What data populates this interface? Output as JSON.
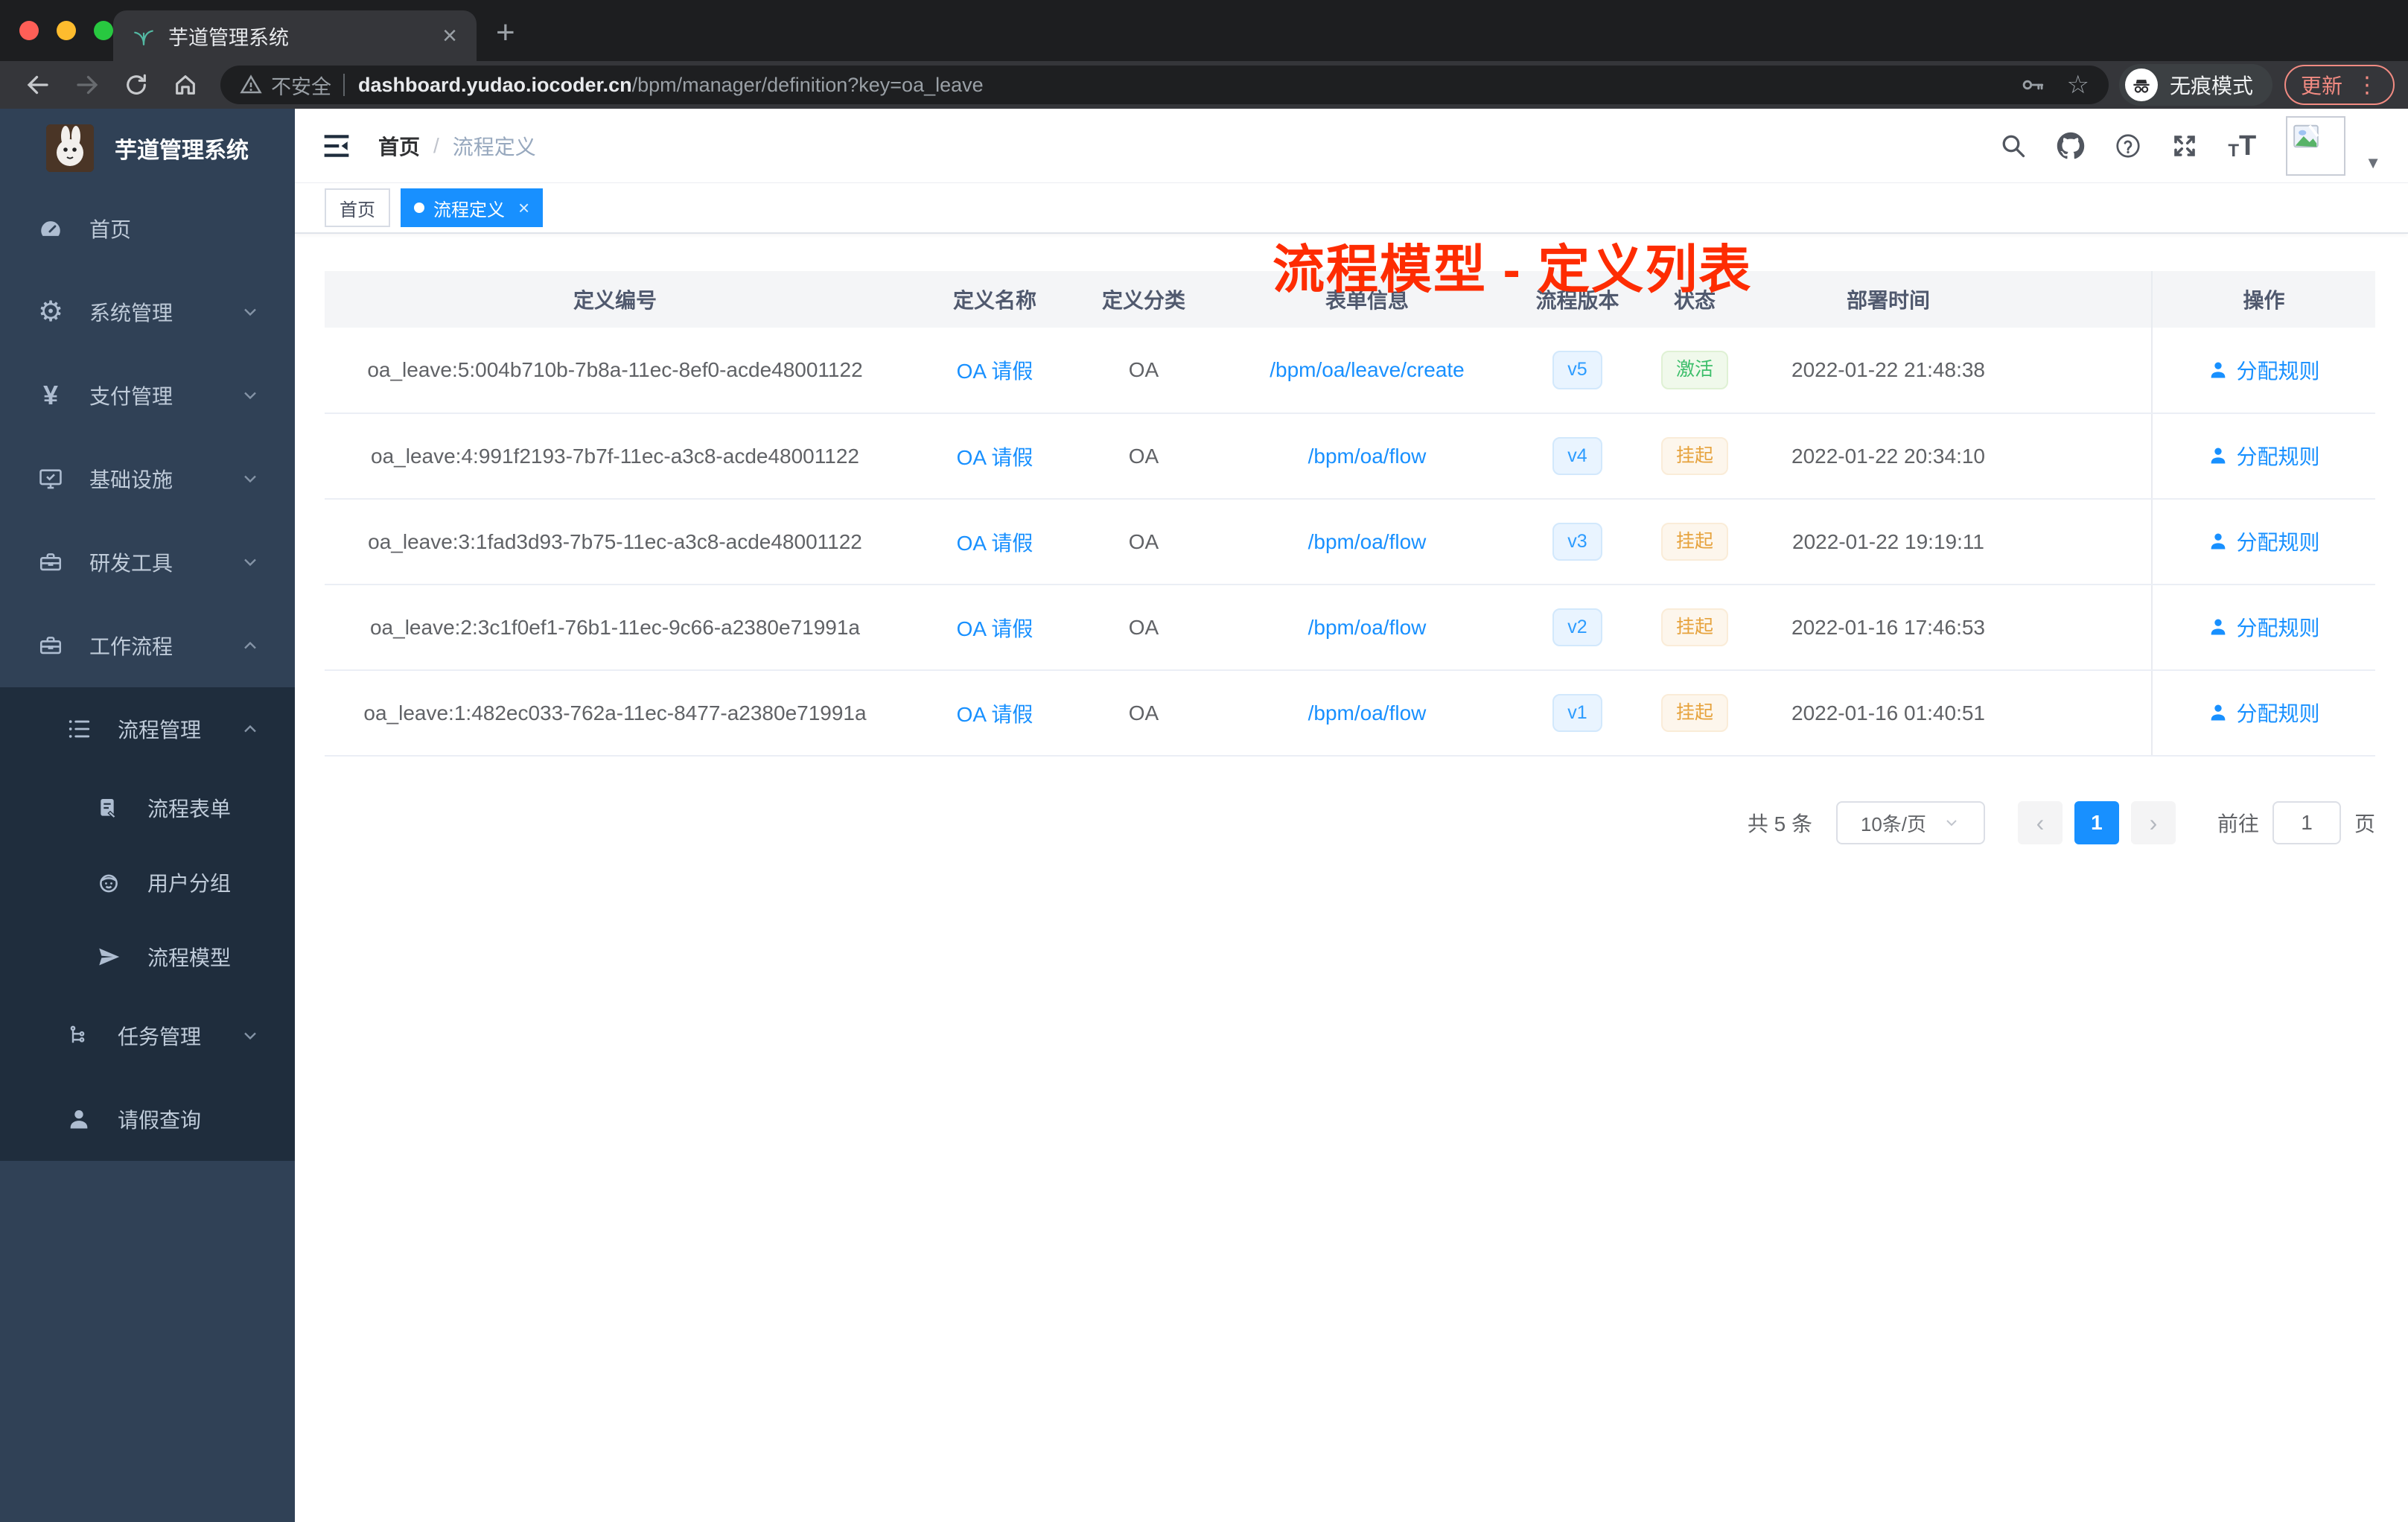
{
  "browser": {
    "tab_title": "芋道管理系统",
    "security": "不安全",
    "domain": "dashboard.yudao.iocoder.cn",
    "path": "/bpm/manager/definition?key=oa_leave",
    "incognito": "无痕模式",
    "update": "更新"
  },
  "icons": {
    "close": "×",
    "plus": "+",
    "kebab": "⋮",
    "caret": "▼",
    "star": "☆",
    "gear": "⚙",
    "yen": "¥",
    "question": "?",
    "prev": "‹",
    "next": "›",
    "font_small": "T",
    "font_large": "T"
  },
  "sidebar": {
    "logo_title": "芋道管理系统",
    "items": [
      {
        "label": "首页"
      },
      {
        "label": "系统管理"
      },
      {
        "label": "支付管理"
      },
      {
        "label": "基础设施"
      },
      {
        "label": "研发工具"
      },
      {
        "label": "工作流程"
      },
      {
        "label": "流程管理"
      },
      {
        "label": "流程表单"
      },
      {
        "label": "用户分组"
      },
      {
        "label": "流程模型"
      },
      {
        "label": "任务管理"
      },
      {
        "label": "请假查询"
      }
    ]
  },
  "navbar": {
    "breadcrumb": [
      "首页",
      "流程定义"
    ],
    "separator": "/"
  },
  "tags": [
    {
      "label": "首页"
    },
    {
      "label": "流程定义"
    }
  ],
  "annotation": {
    "title": "流程模型 - 定义列表"
  },
  "table": {
    "headers": [
      "定义编号",
      "定义名称",
      "定义分类",
      "表单信息",
      "流程版本",
      "状态",
      "部署时间",
      "操作"
    ],
    "action_label": "分配规则",
    "rows": [
      {
        "id": "oa_leave:5:004b710b-7b8a-11ec-8ef0-acde48001122",
        "name": "OA 请假",
        "category": "OA",
        "form": "/bpm/oa/leave/create",
        "version": "v5",
        "status": "激活",
        "time": "2022-01-22 21:48:38"
      },
      {
        "id": "oa_leave:4:991f2193-7b7f-11ec-a3c8-acde48001122",
        "name": "OA 请假",
        "category": "OA",
        "form": "/bpm/oa/flow",
        "version": "v4",
        "status": "挂起",
        "time": "2022-01-22 20:34:10"
      },
      {
        "id": "oa_leave:3:1fad3d93-7b75-11ec-a3c8-acde48001122",
        "name": "OA 请假",
        "category": "OA",
        "form": "/bpm/oa/flow",
        "version": "v3",
        "status": "挂起",
        "time": "2022-01-22 19:19:11"
      },
      {
        "id": "oa_leave:2:3c1f0ef1-76b1-11ec-9c66-a2380e71991a",
        "name": "OA 请假",
        "category": "OA",
        "form": "/bpm/oa/flow",
        "version": "v2",
        "status": "挂起",
        "time": "2022-01-16 17:46:53"
      },
      {
        "id": "oa_leave:1:482ec033-762a-11ec-8477-a2380e71991a",
        "name": "OA 请假",
        "category": "OA",
        "form": "/bpm/oa/flow",
        "version": "v1",
        "status": "挂起",
        "time": "2022-01-16 01:40:51"
      }
    ]
  },
  "pagination": {
    "total": "共 5 条",
    "page_size": "10条/页",
    "current": "1",
    "goto_label": "前往",
    "goto_value": "1",
    "page_unit": "页"
  }
}
